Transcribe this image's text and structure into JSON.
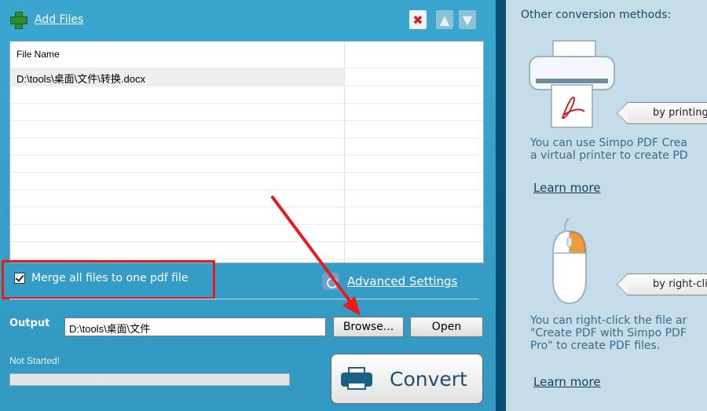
{
  "toolbar": {
    "add_files_label": "Add Files",
    "delete_icon": "✖",
    "up_icon": "▲",
    "down_icon": "▼"
  },
  "file_list": {
    "header": "File Name",
    "files": [
      "D:\\tools\\桌面\\文件\\转换.docx"
    ]
  },
  "merge": {
    "label": "Merge all files to one pdf file",
    "checked": true
  },
  "advanced_settings_label": "Advanced Settings",
  "output": {
    "label": "Output",
    "path": "D:\\tools\\桌面\\文件",
    "browse_label": "Browse...",
    "open_label": "Open"
  },
  "status": {
    "text": "Not Started!",
    "progress": 0
  },
  "convert_label": "Convert",
  "right_panel": {
    "title": "Other conversion methods:",
    "printing": {
      "tag": "by printing",
      "text_line1": "You can use Simpo PDF Crea",
      "text_line2": "a virtual printer to create PD",
      "link": "Learn more"
    },
    "right_click": {
      "tag": "by right-clic",
      "text_line1": "You can right-click the file ar",
      "text_line2": "\"Create PDF with Simpo PDF",
      "text_line3": "Pro\" to create PDF files.",
      "link": "Learn more"
    }
  },
  "colors": {
    "panel_blue": "#3aa6cf",
    "divider": "#0a4e74",
    "right_bg": "#c4dde9",
    "highlight_red": "#e81b1b"
  }
}
